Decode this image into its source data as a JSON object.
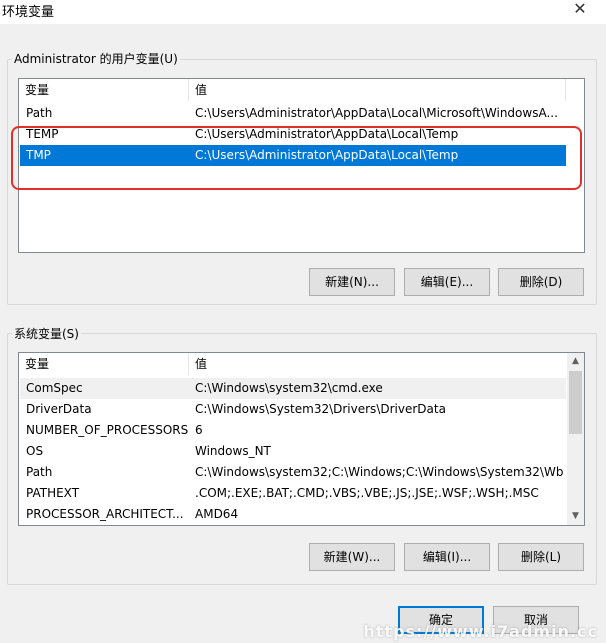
{
  "window": {
    "title": "环境变量",
    "close_glyph": "✕"
  },
  "user_vars": {
    "group_label": "Administrator 的用户变量(U)",
    "columns": [
      "变量",
      "值"
    ],
    "rows": [
      {
        "name": "Path",
        "value": "C:\\Users\\Administrator\\AppData\\Local\\Microsoft\\WindowsA..."
      },
      {
        "name": "TEMP",
        "value": "C:\\Users\\Administrator\\AppData\\Local\\Temp"
      },
      {
        "name": "TMP",
        "value": "C:\\Users\\Administrator\\AppData\\Local\\Temp"
      }
    ],
    "selected_row": 2,
    "buttons": {
      "new": "新建(N)...",
      "edit": "编辑(E)...",
      "delete": "删除(D)"
    }
  },
  "system_vars": {
    "group_label": "系统变量(S)",
    "columns": [
      "变量",
      "值"
    ],
    "rows": [
      {
        "name": "ComSpec",
        "value": "C:\\Windows\\system32\\cmd.exe"
      },
      {
        "name": "DriverData",
        "value": "C:\\Windows\\System32\\Drivers\\DriverData"
      },
      {
        "name": "NUMBER_OF_PROCESSORS",
        "value": "6"
      },
      {
        "name": "OS",
        "value": "Windows_NT"
      },
      {
        "name": "Path",
        "value": "C:\\Windows\\system32;C:\\Windows;C:\\Windows\\System32\\Wb..."
      },
      {
        "name": "PATHEXT",
        "value": ".COM;.EXE;.BAT;.CMD;.VBS;.VBE;.JS;.JSE;.WSF;.WSH;.MSC"
      },
      {
        "name": "PROCESSOR_ARCHITECT...",
        "value": "AMD64"
      }
    ],
    "buttons": {
      "new": "新建(W)...",
      "edit": "编辑(I)...",
      "delete": "删除(L)"
    }
  },
  "dialog_buttons": {
    "ok": "确定",
    "cancel": "取消"
  },
  "watermark": "https://www.i7admin.cc",
  "colors": {
    "selection": "#0078d7",
    "highlight_box": "#e0302b"
  }
}
